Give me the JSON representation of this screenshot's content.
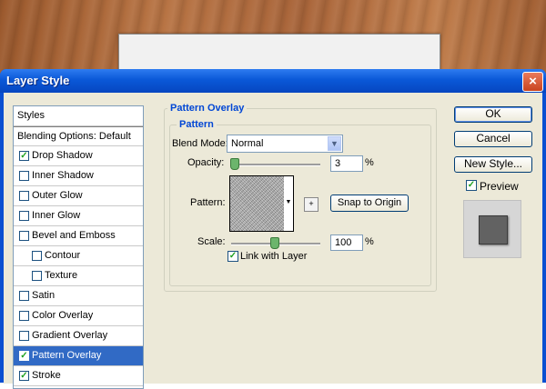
{
  "dialog": {
    "title": "Layer Style",
    "close_glyph": "×"
  },
  "styles_list": [
    {
      "label": "Styles",
      "checkbox": false,
      "checked": false,
      "selected": false
    },
    {
      "label": "Blending Options: Default",
      "checkbox": false,
      "checked": false,
      "selected": false
    },
    {
      "label": "Drop Shadow",
      "checkbox": true,
      "checked": true,
      "selected": false
    },
    {
      "label": "Inner Shadow",
      "checkbox": true,
      "checked": false,
      "selected": false
    },
    {
      "label": "Outer Glow",
      "checkbox": true,
      "checked": false,
      "selected": false
    },
    {
      "label": "Inner Glow",
      "checkbox": true,
      "checked": false,
      "selected": false
    },
    {
      "label": "Bevel and Emboss",
      "checkbox": true,
      "checked": false,
      "selected": false
    },
    {
      "label": "Contour",
      "checkbox": true,
      "checked": false,
      "selected": false
    },
    {
      "label": "Texture",
      "checkbox": true,
      "checked": false,
      "selected": false
    },
    {
      "label": "Satin",
      "checkbox": true,
      "checked": false,
      "selected": false
    },
    {
      "label": "Color Overlay",
      "checkbox": true,
      "checked": false,
      "selected": false
    },
    {
      "label": "Gradient Overlay",
      "checkbox": true,
      "checked": false,
      "selected": false
    },
    {
      "label": "Pattern Overlay",
      "checkbox": true,
      "checked": true,
      "selected": true
    },
    {
      "label": "Stroke",
      "checkbox": true,
      "checked": true,
      "selected": false
    }
  ],
  "panel": {
    "section_title": "Pattern Overlay",
    "group_title": "Pattern",
    "blend_mode_label": "Blend Mode:",
    "blend_mode_value": "Normal",
    "opacity_label": "Opacity:",
    "opacity_value": "3",
    "opacity_unit": "%",
    "pattern_label": "Pattern:",
    "snap_button": "Snap to Origin",
    "scale_label": "Scale:",
    "scale_value": "100",
    "scale_unit": "%",
    "link_label": "Link with Layer",
    "link_checked": true
  },
  "buttons": {
    "ok": "OK",
    "cancel": "Cancel",
    "new_style": "New Style...",
    "preview_label": "Preview",
    "preview_checked": true
  },
  "check_glyph": "✓"
}
